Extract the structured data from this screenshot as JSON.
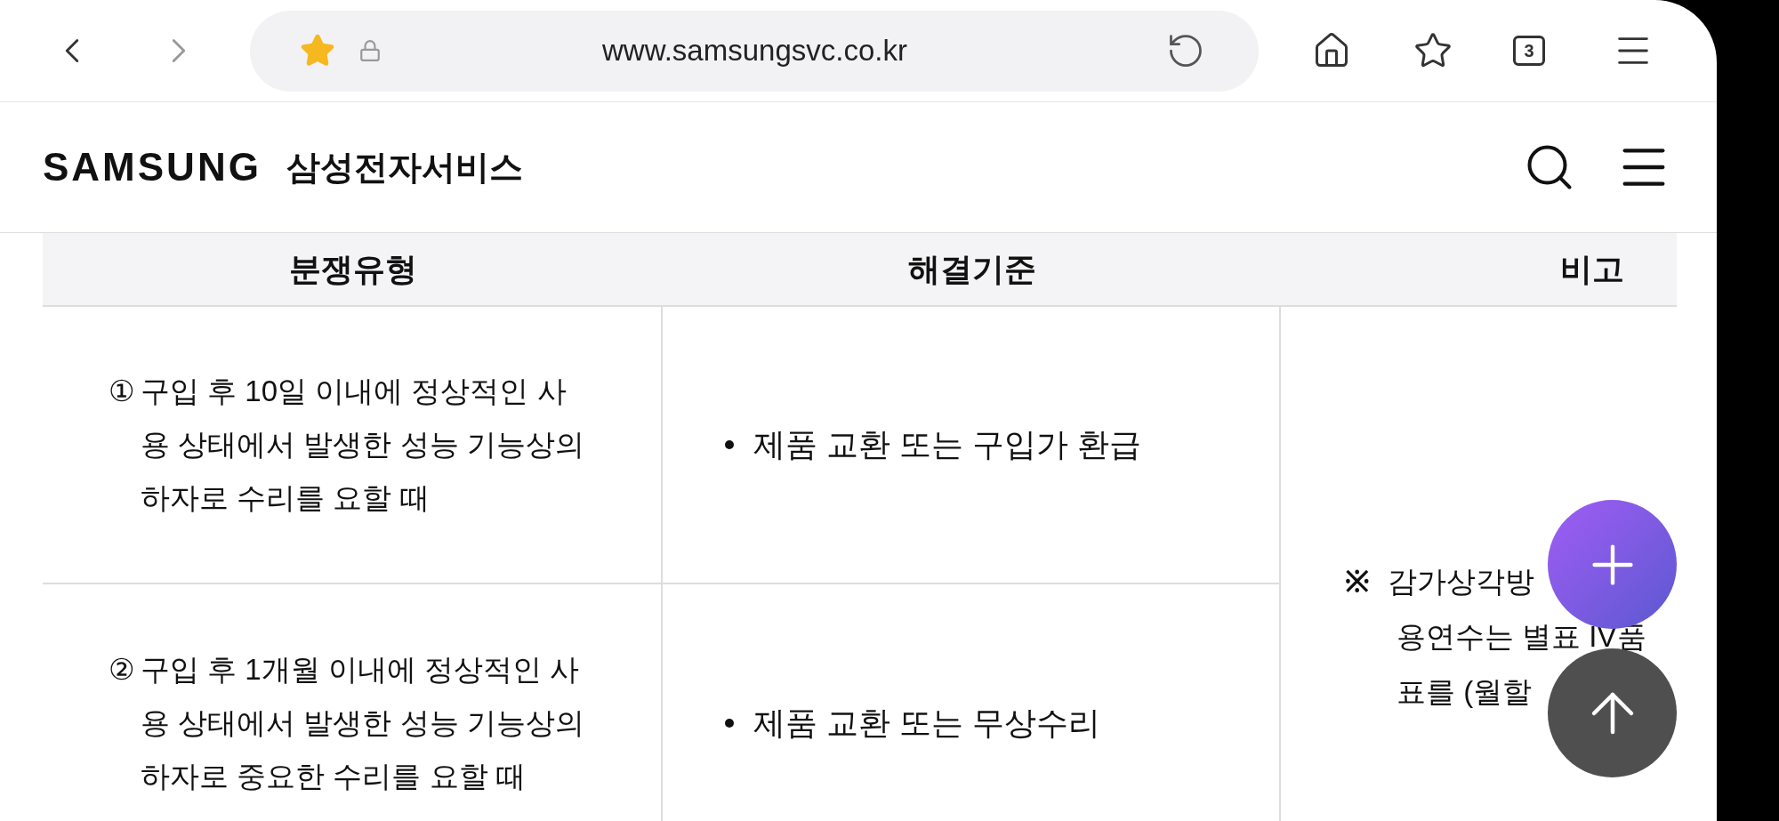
{
  "browser": {
    "url": "www.samsungsvc.co.kr",
    "tab_count": "3"
  },
  "header": {
    "logo": "SAMSUNG",
    "title": "삼성전자서비스"
  },
  "table": {
    "columns": [
      "분쟁유형",
      "해결기준",
      "비고"
    ],
    "rows": [
      {
        "num": "①",
        "type": "구입 후 10일 이내에 정상적인 사용 상태에서 발생한 성능 기능상의 하자로 수리를 요할 때",
        "resolution": "제품 교환 또는 구입가 환급"
      },
      {
        "num": "②",
        "type": "구입 후 1개월 이내에 정상적인 사용 상태에서 발생한 성능 기능상의 하자로 중요한 수리를  요할 때",
        "resolution": "제품 교환 또는 무상수리"
      }
    ],
    "note": {
      "mark": "※",
      "lines": [
        "감가상각방",
        "용연수는 별표 IV품",
        "표를 (월할"
      ]
    }
  }
}
